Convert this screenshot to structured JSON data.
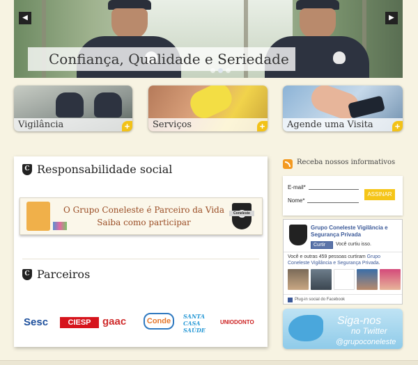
{
  "hero": {
    "caption": "Confiança, Qualidade e Seriedade",
    "prev_icon": "chevron-left-icon",
    "next_icon": "chevron-right-icon",
    "slides": 3,
    "active_slide": 1
  },
  "features": [
    {
      "label": "Vigilância",
      "icon": "plus-icon"
    },
    {
      "label": "Serviços",
      "icon": "plus-icon"
    },
    {
      "label": "Agende uma Visita",
      "icon": "plus-icon"
    }
  ],
  "social": {
    "title": "Responsabilidade social",
    "promo_line1": "O Grupo Coneleste é Parceiro da Vida",
    "promo_line2": "Saiba como participar",
    "shield_letter": "C",
    "shield_band": "Coneleste"
  },
  "partners": {
    "title": "Parceiros",
    "logos": [
      "Sesc",
      "CIESP",
      "gaac",
      "Conde",
      "SANTA CASA SAÚDE",
      "UNIODONTO"
    ]
  },
  "newsletter": {
    "title": "Receba nossos informativos",
    "email_label": "E-mail*",
    "name_label": "Nome*",
    "submit_label": "ASSINAR"
  },
  "facebook": {
    "page_name": "Grupo Coneleste Vigilância e Segurança Privada",
    "like_label": "Curtir",
    "liked_text": "Você curtiu isso.",
    "count_text_prefix": "Você e outras 459 pessoas curtiram ",
    "count_text_link": "Grupo Coneleste Vigilância e Segurança Privada",
    "count_text_suffix": ".",
    "plugin_label": "Plug-in social do Facebook"
  },
  "twitter": {
    "line1": "Siga-nos",
    "line2": "no Twitter",
    "handle": "@grupoconeleste"
  },
  "colors": {
    "background": "#f7f3e2",
    "accent_yellow": "#f2c218",
    "facebook_blue": "#3b5998"
  }
}
